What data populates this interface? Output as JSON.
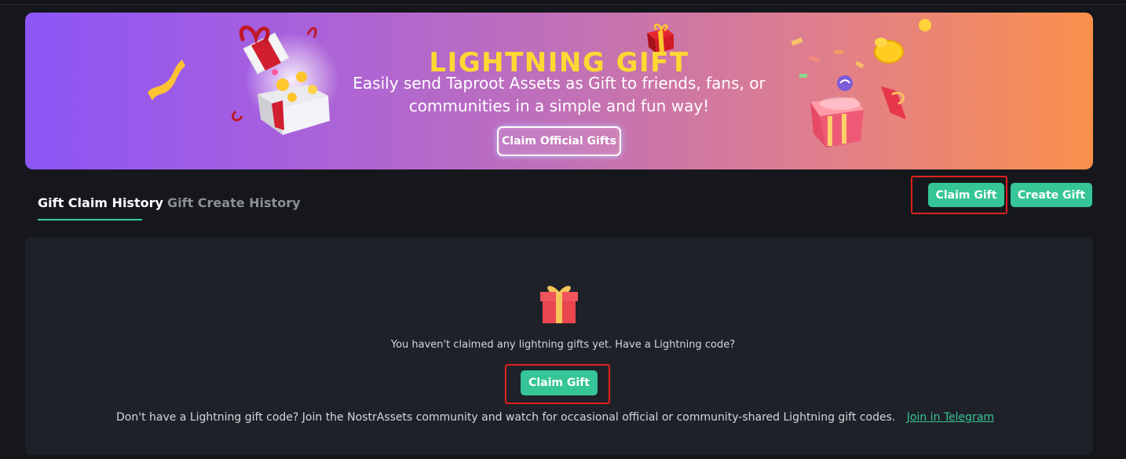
{
  "banner": {
    "title": "LIGHTNING GIFT",
    "subtitle": "Easily send Taproot Assets as Gift to friends, fans, or communities in a simple and fun way!",
    "cta_label": "Claim Official Gifts"
  },
  "tabs": [
    {
      "label": "Gift Claim History",
      "active": true
    },
    {
      "label": "Gift Create History",
      "active": false
    }
  ],
  "actions": {
    "claim_gift_label": "Claim Gift",
    "create_gift_label": "Create Gift"
  },
  "empty_state": {
    "icon": "gift-icon",
    "message": "You haven't claimed any lightning gifts yet. Have a Lightning code?",
    "claim_button_label": "Claim Gift",
    "community_text": "Don't have a Lightning gift code? Join the NostrAssets community and watch for occasional official or community-shared Lightning gift codes.",
    "telegram_link": "Join in Telegram"
  },
  "colors": {
    "accent": "#35c596",
    "highlight": "#e0211b",
    "banner_gradient_start": "#8c55f6",
    "banner_gradient_end": "#fb904c",
    "title_yellow": "#ffd933"
  }
}
